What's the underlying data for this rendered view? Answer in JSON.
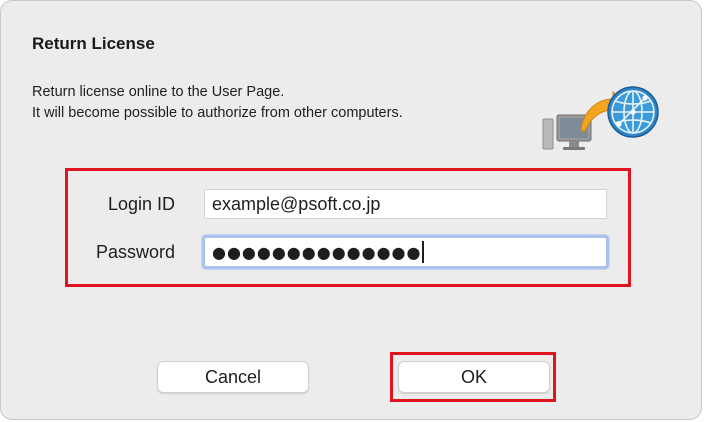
{
  "dialog": {
    "title": "Return License",
    "description_lines": [
      "Return license online to the User Page.",
      "It will become possible to authorize from other computers."
    ],
    "graphic_icon": "computer-to-globe-icon"
  },
  "form": {
    "login_label": "Login ID",
    "login_value": "example@psoft.co.jp",
    "password_label": "Password",
    "password_value": "●●●●●●●●●●●●●●"
  },
  "buttons": {
    "cancel_label": "Cancel",
    "ok_label": "OK"
  },
  "colors": {
    "highlight": "#e0141e",
    "focus_ring": "#a9c3ec",
    "dialog_bg": "#ececec"
  }
}
